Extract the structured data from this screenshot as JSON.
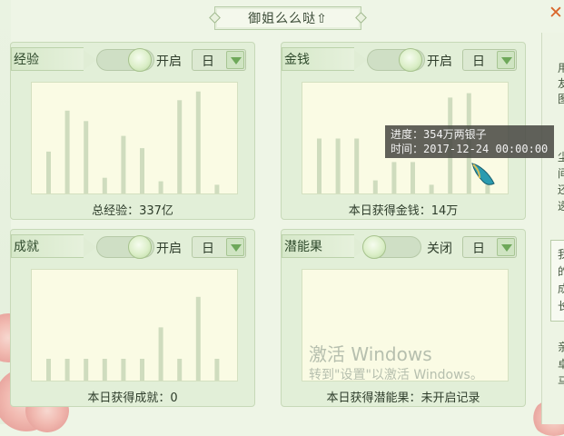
{
  "window": {
    "title": "御姐么么哒⇧",
    "close_label": "✕"
  },
  "side_text": [
    "用",
    "友",
    "图",
    "尘",
    "间",
    "还",
    "递",
    "我",
    "的",
    "成",
    "长",
    "亲",
    "卓",
    "马"
  ],
  "panels": [
    {
      "label": "经验",
      "toggle": {
        "state": "on",
        "text": "开启"
      },
      "period": "日",
      "caption": "总经验：337亿",
      "chart_data": {
        "type": "bar",
        "values": [
          48,
          95,
          83,
          18,
          66,
          52,
          14,
          107,
          117,
          10
        ],
        "ylim": [
          0,
          125
        ]
      }
    },
    {
      "label": "金钱",
      "toggle": {
        "state": "on",
        "text": "开启"
      },
      "period": "日",
      "caption": "本日获得金钱：14万",
      "chart_data": {
        "type": "bar",
        "values": [
          63,
          63,
          63,
          15,
          36,
          36,
          10,
          110,
          115,
          10
        ],
        "ylim": [
          0,
          125
        ]
      }
    },
    {
      "label": "成就",
      "toggle": {
        "state": "on",
        "text": "开启"
      },
      "period": "日",
      "caption": "本日获得成就：0",
      "chart_data": {
        "type": "bar",
        "values": [
          25,
          25,
          25,
          25,
          25,
          25,
          61,
          25,
          96,
          25
        ],
        "ylim": [
          0,
          125
        ]
      }
    },
    {
      "label": "潜能果",
      "toggle": {
        "state": "off",
        "text": "关闭"
      },
      "period": "日",
      "caption": "本日获得潜能果：未开启记录",
      "chart_data": {
        "type": "bar",
        "values": [],
        "ylim": [
          0,
          125
        ]
      }
    }
  ],
  "tooltip": {
    "line1": "进度：354万两银子",
    "line2": "时间：2017-12-24 00:00:00"
  },
  "watermark": {
    "title": "激活 Windows",
    "subtitle": "转到\"设置\"以激活 Windows。"
  },
  "colors": {
    "bar": "#cfdcbe",
    "chart_bg": "#fafbe4",
    "panel_bg": "#e2efd8",
    "close": "#d9662b"
  }
}
